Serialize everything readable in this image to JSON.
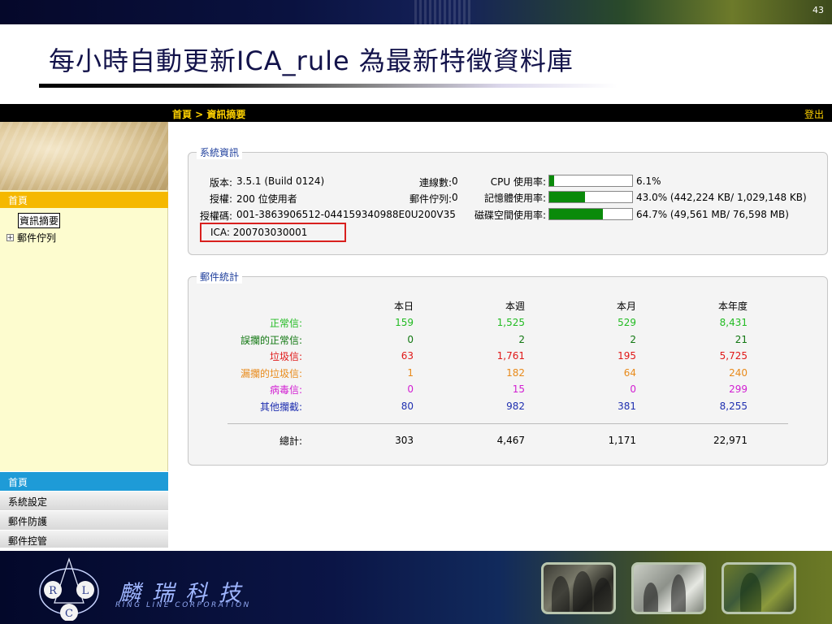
{
  "slide": {
    "number": "43",
    "title": "每小時自動更新ICA_rule 為最新特徵資料庫"
  },
  "app": {
    "breadcrumb": "首頁 > 資訊摘要",
    "logout": "登出",
    "sidebar": {
      "header": "首頁",
      "items": [
        "資訊摘要",
        "郵件佇列"
      ],
      "bottom_nav": [
        "首頁",
        "系統設定",
        "郵件防護",
        "郵件控管"
      ]
    },
    "system_info": {
      "legend": "系統資訊",
      "version_label": "版本:",
      "version_value": "3.5.1 (Build 0124)",
      "license_label": "授權:",
      "license_value": "200 位使用者",
      "license_code_label": "授權碼:",
      "license_code_value": "001-3863906512-044159340988E0U200V35",
      "ica_label": "ICA:",
      "ica_value": "200703030001",
      "connections_label": "連線數:",
      "connections_value": "0",
      "mail_queue_label": "郵件佇列:",
      "mail_queue_value": "0",
      "cpu_label": "CPU 使用率:",
      "cpu_value": "6.1%",
      "cpu_fraction": 0.061,
      "memory_label": "記憶體使用率:",
      "memory_value": "43.0% (442,224 KB/ 1,029,148 KB)",
      "memory_fraction": 0.43,
      "disk_label": "磁碟空間使用率:",
      "disk_value": "64.7% (49,561 MB/ 76,598 MB)",
      "disk_fraction": 0.647
    },
    "mail_stats": {
      "legend": "郵件統計",
      "columns": [
        "本日",
        "本週",
        "本月",
        "本年度"
      ],
      "rows": [
        {
          "label": "正常信:",
          "color": "#22bb22",
          "values": [
            "159",
            "1,525",
            "529",
            "8,431"
          ]
        },
        {
          "label": "誤攔的正常信:",
          "color": "#117711",
          "values": [
            "0",
            "2",
            "2",
            "21"
          ]
        },
        {
          "label": "垃圾信:",
          "color": "#e01818",
          "values": [
            "63",
            "1,761",
            "195",
            "5,725"
          ]
        },
        {
          "label": "漏攔的垃圾信:",
          "color": "#e88a1a",
          "values": [
            "1",
            "182",
            "64",
            "240"
          ]
        },
        {
          "label": "病毒信:",
          "color": "#d21ed2",
          "values": [
            "0",
            "15",
            "0",
            "299"
          ]
        },
        {
          "label": "其他攔截:",
          "color": "#1f2fb0",
          "values": [
            "80",
            "982",
            "381",
            "8,255"
          ]
        }
      ],
      "total": {
        "label": "總計:",
        "values": [
          "303",
          "4,467",
          "1,171",
          "22,971"
        ]
      }
    }
  },
  "footer": {
    "logo_letters": [
      "R",
      "L",
      "C"
    ],
    "company_name": "麟瑞科技",
    "company_english": "RING LINE CORPORATION"
  },
  "colors": {
    "breadcrumb": "#ffd200",
    "sidebar_header": "#f5b800",
    "nav_home": "#1e9bd7",
    "bar_fill": "#0a8a0a",
    "ica_highlight": "#d8201e",
    "legend_text": "#1f3f9c"
  }
}
